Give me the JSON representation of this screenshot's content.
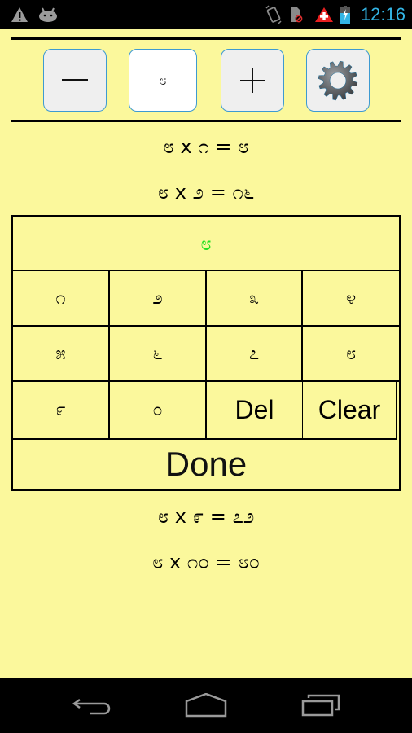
{
  "status_bar": {
    "time": "12:16",
    "left_icons": [
      "warning-icon",
      "android-debug-icon"
    ],
    "right_icons": [
      "vibrate-icon",
      "no-sim-icon",
      "first-aid-icon",
      "battery-charging-icon"
    ],
    "time_color": "#33b5e5"
  },
  "toolbar": {
    "decrement_label": "—",
    "table_value": "೮",
    "increment_label": "+",
    "settings_icon": "gear-icon"
  },
  "equations_above": [
    {
      "lhs_a": "೮",
      "op": "x",
      "lhs_b": "೧",
      "eq": "=",
      "rhs": "೮"
    },
    {
      "lhs_a": "೮",
      "op": "x",
      "lhs_b": "೨",
      "eq": "=",
      "rhs": "೧೬"
    }
  ],
  "keypad": {
    "answer": "೮",
    "answer_color": "#22e022",
    "rows": [
      [
        "೧",
        "೨",
        "೩",
        "೪"
      ],
      [
        "೫",
        "೬",
        "೭",
        "೮"
      ],
      [
        "೯",
        "೦",
        "Del",
        "Clear"
      ]
    ],
    "done_label": "Done"
  },
  "equations_below": [
    {
      "lhs_a": "೮",
      "op": "x",
      "lhs_b": "೯",
      "eq": "=",
      "rhs": "೭೨"
    },
    {
      "lhs_a": "೮",
      "op": "x",
      "lhs_b": "೧೦",
      "eq": "=",
      "rhs": "೮೦"
    }
  ],
  "colors": {
    "background": "#fbf89c",
    "button_border": "#3d9ad1"
  },
  "nav_bar": {
    "buttons": [
      "back-icon",
      "home-icon",
      "recent-apps-icon"
    ]
  }
}
